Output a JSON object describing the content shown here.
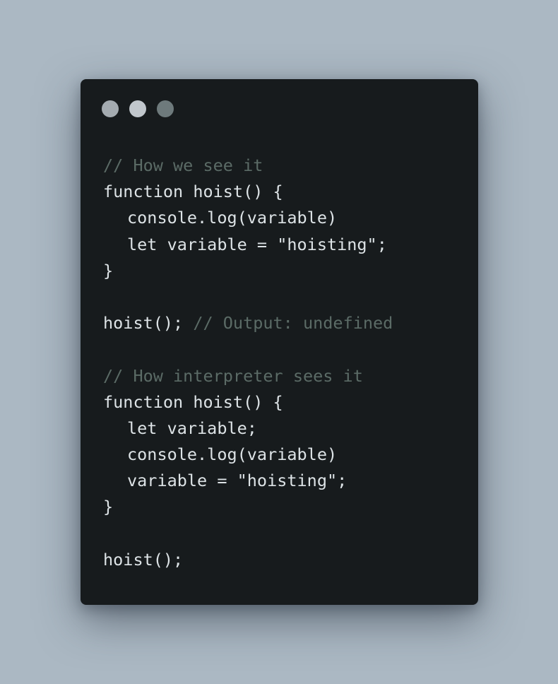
{
  "colors": {
    "background": "#abb8c3",
    "window": "#171b1d",
    "code_text": "#dde3e6",
    "comment": "#5b6b66",
    "dot_1": "#a4abb0",
    "dot_2": "#c1c7cc",
    "dot_3": "#6e7a7c"
  },
  "window_controls": [
    "dot",
    "dot",
    "dot"
  ],
  "code": [
    {
      "indent": 0,
      "segments": [
        {
          "text": "// How we see it",
          "kind": "comment"
        }
      ]
    },
    {
      "indent": 0,
      "segments": [
        {
          "text": "function hoist() {",
          "kind": "code"
        }
      ]
    },
    {
      "indent": 1,
      "segments": [
        {
          "text": "console.log(variable)",
          "kind": "code"
        }
      ]
    },
    {
      "indent": 1,
      "segments": [
        {
          "text": "let variable = \"hoisting\";",
          "kind": "code"
        }
      ]
    },
    {
      "indent": 0,
      "segments": [
        {
          "text": "}",
          "kind": "code"
        }
      ]
    },
    {
      "indent": 0,
      "segments": []
    },
    {
      "indent": 0,
      "segments": [
        {
          "text": "hoist(); ",
          "kind": "code"
        },
        {
          "text": "// Output: undefined",
          "kind": "comment"
        }
      ]
    },
    {
      "indent": 0,
      "segments": []
    },
    {
      "indent": 0,
      "segments": [
        {
          "text": "// How interpreter sees it",
          "kind": "comment"
        }
      ]
    },
    {
      "indent": 0,
      "segments": [
        {
          "text": "function hoist() {",
          "kind": "code"
        }
      ]
    },
    {
      "indent": 1,
      "segments": [
        {
          "text": "let variable;",
          "kind": "code"
        }
      ]
    },
    {
      "indent": 1,
      "segments": [
        {
          "text": "console.log(variable)",
          "kind": "code"
        }
      ]
    },
    {
      "indent": 1,
      "segments": [
        {
          "text": "variable = \"hoisting\";",
          "kind": "code"
        }
      ]
    },
    {
      "indent": 0,
      "segments": [
        {
          "text": "}",
          "kind": "code"
        }
      ]
    },
    {
      "indent": 0,
      "segments": []
    },
    {
      "indent": 0,
      "segments": [
        {
          "text": "hoist();",
          "kind": "code"
        }
      ]
    }
  ]
}
